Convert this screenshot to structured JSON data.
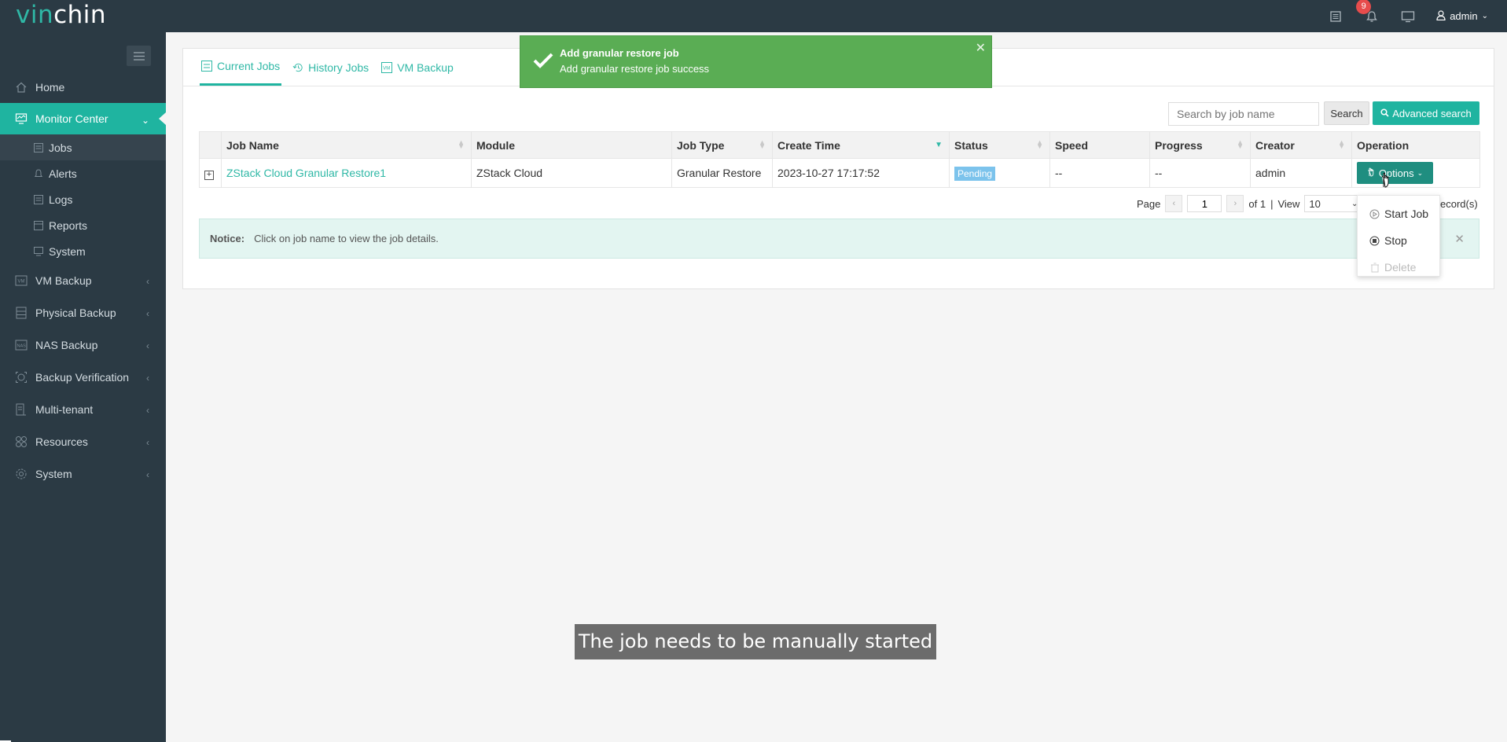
{
  "app": {
    "logo_part1": "vin",
    "logo_part2": "chin",
    "notification_count": "9",
    "user": "admin"
  },
  "sidebar": {
    "items": [
      {
        "label": "Home",
        "icon": "home-icon"
      },
      {
        "label": "Monitor Center",
        "icon": "monitor-icon",
        "active": true
      },
      {
        "label": "VM Backup",
        "icon": "vm-icon"
      },
      {
        "label": "Physical Backup",
        "icon": "server-icon"
      },
      {
        "label": "NAS Backup",
        "icon": "nas-icon"
      },
      {
        "label": "Backup Verification",
        "icon": "verify-icon"
      },
      {
        "label": "Multi-tenant",
        "icon": "tenant-icon"
      },
      {
        "label": "Resources",
        "icon": "resources-icon"
      },
      {
        "label": "System",
        "icon": "gear-icon"
      }
    ],
    "sub_items": [
      {
        "label": "Jobs",
        "active": true
      },
      {
        "label": "Alerts"
      },
      {
        "label": "Logs"
      },
      {
        "label": "Reports"
      },
      {
        "label": "System"
      }
    ]
  },
  "tabs": [
    {
      "label": "Current Jobs",
      "active": true
    },
    {
      "label": "History Jobs"
    },
    {
      "label": "VM Backup"
    }
  ],
  "search": {
    "placeholder": "Search by job name",
    "button": "Search",
    "advanced": "Advanced search"
  },
  "table": {
    "columns": [
      "Job Name",
      "Module",
      "Job Type",
      "Create Time",
      "Status",
      "Speed",
      "Progress",
      "Creator",
      "Operation"
    ],
    "rows": [
      {
        "job_name": "ZStack Cloud Granular Restore1",
        "module": "ZStack Cloud",
        "job_type": "Granular Restore",
        "create_time": "2023-10-27 17:17:52",
        "status": "Pending",
        "speed": "--",
        "progress": "--",
        "creator": "admin",
        "operation": "Options"
      }
    ]
  },
  "pager": {
    "page_label": "Page",
    "page": "1",
    "of": "of 1",
    "sep": "|",
    "view_label": "View",
    "view": "10",
    "records": "ecord(s)"
  },
  "notice": {
    "label": "Notice:",
    "text": "Click on job name to view the job details."
  },
  "dropdown": {
    "items": [
      {
        "label": "Start Job",
        "disabled": false
      },
      {
        "label": "Stop",
        "disabled": false
      },
      {
        "label": "Delete",
        "disabled": true
      }
    ]
  },
  "toast": {
    "title": "Add granular restore job",
    "message": "Add granular restore job success"
  },
  "caption": "The job needs to be manually started",
  "colors": {
    "accent": "#1fb4a0",
    "sidebar_bg": "#2b3a44",
    "toast_bg": "#5aad54",
    "status_pending": "#7cc3ec"
  }
}
